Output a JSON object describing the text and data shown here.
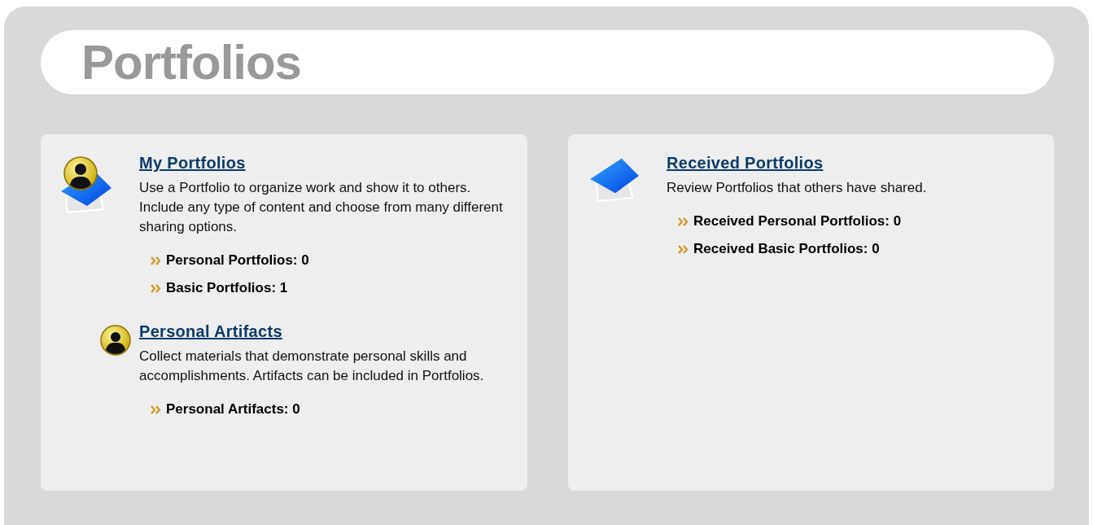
{
  "page_title": "Portfolios",
  "panels": [
    {
      "sections": [
        {
          "kind": "portfolio-user",
          "title": "My Portfolios",
          "description": "Use a Portfolio to organize work and show it to others. Include any type of content and choose from many different sharing options.",
          "items": [
            "Personal Portfolios: 0",
            "Basic Portfolios: 1"
          ]
        },
        {
          "kind": "user",
          "title": "Personal Artifacts",
          "description": "Collect materials that demonstrate personal skills and accomplishments. Artifacts can be included in Portfolios.",
          "items": [
            "Personal Artifacts: 0"
          ]
        }
      ]
    },
    {
      "sections": [
        {
          "kind": "portfolio",
          "title": "Received Portfolios",
          "description": "Review Portfolios that others have shared.",
          "items": [
            "Received Personal Portfolios: 0",
            "Received Basic Portfolios: 0"
          ]
        }
      ]
    }
  ]
}
